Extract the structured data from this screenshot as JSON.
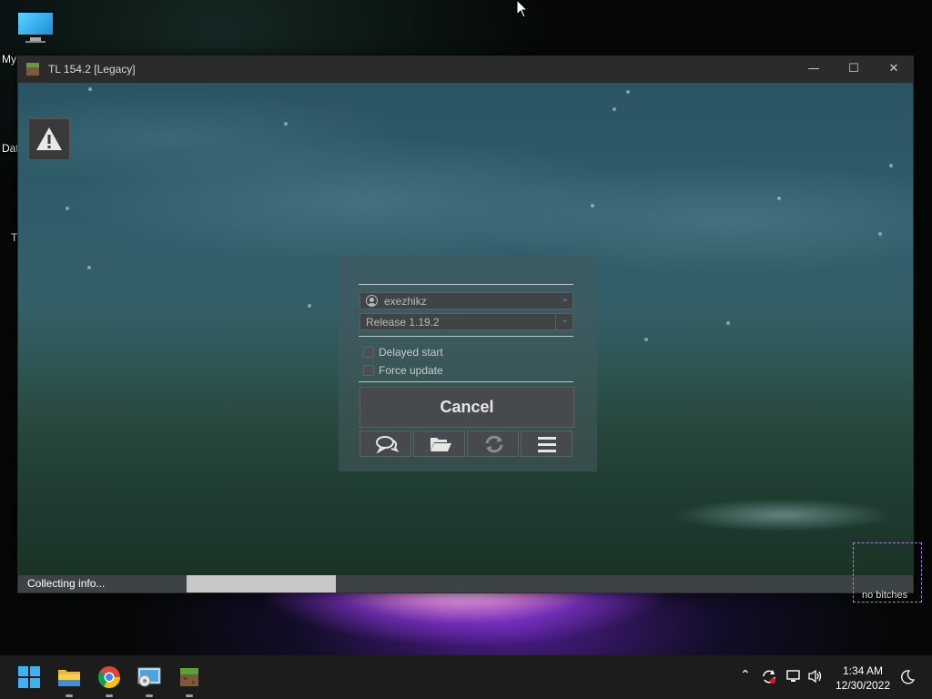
{
  "desktop": {
    "icons": [
      {
        "label": "My",
        "icon": "monitor-icon"
      },
      {
        "label": "Dat"
      },
      {
        "label": "T"
      }
    ]
  },
  "window": {
    "title": "TL 154.2 [Legacy]",
    "controls": {
      "minimize": "—",
      "maximize": "☐",
      "close": "✕"
    }
  },
  "launcher": {
    "account": "exezhikz",
    "version": "Release 1.19.2",
    "options": [
      {
        "label": "Delayed start",
        "checked": false
      },
      {
        "label": "Force update",
        "checked": false
      }
    ],
    "cancel_label": "Cancel",
    "toolbar": [
      "chat-icon",
      "folder-icon",
      "refresh-icon",
      "menu-icon"
    ]
  },
  "status": {
    "text": "Collecting info...",
    "progress_fraction": 0.17
  },
  "tooltip": {
    "text": "no bitches"
  },
  "taskbar": {
    "apps": [
      "windows-start-icon",
      "file-explorer-icon",
      "chrome-icon",
      "control-panel-icon",
      "minecraft-launcher-icon"
    ],
    "tray_icons": [
      "chevron-up-icon",
      "update-icon",
      "network-icon",
      "volume-icon",
      "moon-icon"
    ],
    "time": "1:34 AM",
    "date": "12/30/2022"
  },
  "colors": {
    "titlebar": "#2b2b2b",
    "panel": "#474a4c",
    "progress": "#c7c7c7",
    "taskbar": "#1c1c1c"
  }
}
